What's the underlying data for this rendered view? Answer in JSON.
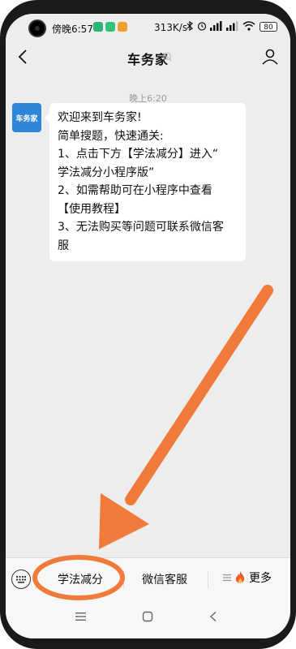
{
  "status_bar": {
    "time": "傍晚6:57",
    "speed": "313K/s",
    "battery": "80"
  },
  "header": {
    "title": "车务家"
  },
  "chat": {
    "timestamp": "晚上6:20",
    "avatar_label": "车务家",
    "message_lines": [
      "欢迎来到车务家!",
      "简单搜题，快速通关:",
      "1、点击下方【学法减分】进入“",
      "学法减分小程序版”",
      "2、如需帮助可在小程序中查看",
      "【使用教程】",
      "3、无法购买等问题可联系微信客",
      "服"
    ]
  },
  "bottom_menu": {
    "items": [
      "学法减分",
      "微信客服"
    ],
    "more_label": "更多"
  },
  "colors": {
    "accent_orange": "#f07a3a",
    "avatar_blue": "#2f86d8"
  },
  "icons": {
    "back": "back-arrow-icon",
    "mute": "bell-mute-icon",
    "profile": "person-icon",
    "keyboard": "keyboard-icon",
    "hamburger": "hamburger-icon",
    "fire": "fire-icon"
  }
}
